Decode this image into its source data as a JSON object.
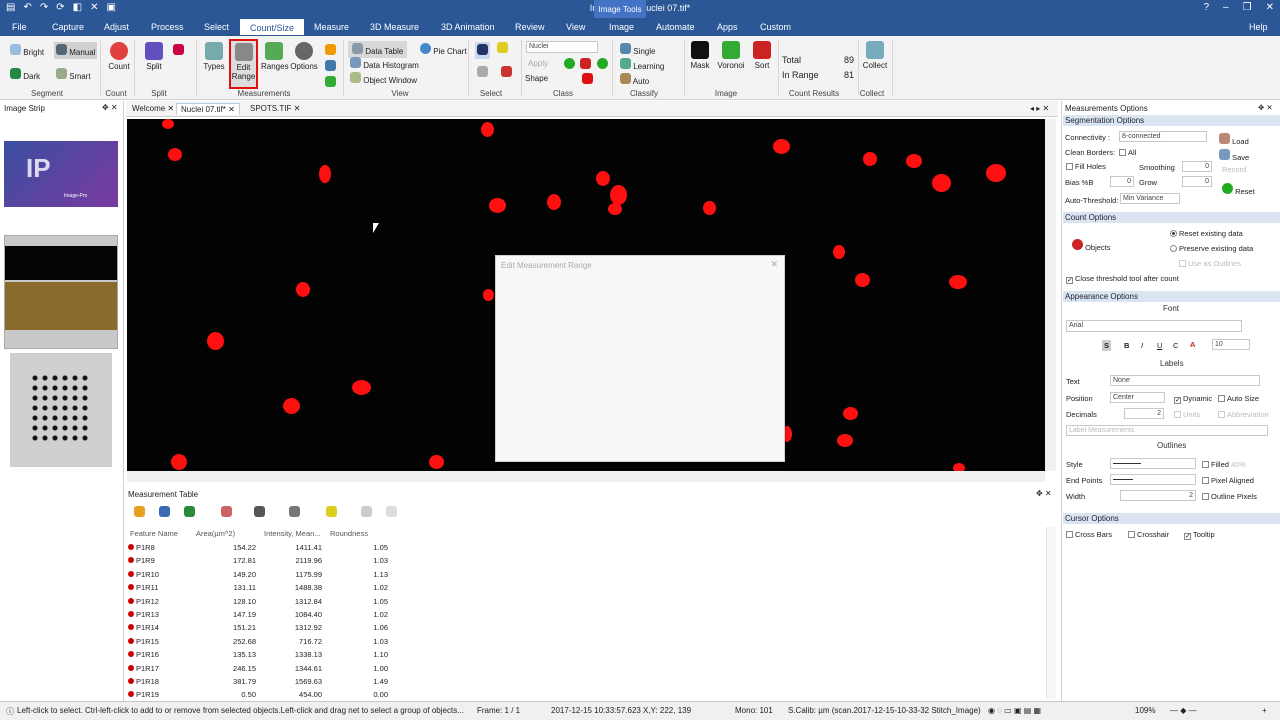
{
  "app": {
    "title": "Image-Pro - Nuclei 07.tif*",
    "context_tab_group": "Image Tools"
  },
  "menu": [
    "File",
    "Capture",
    "Adjust",
    "Process",
    "Select",
    "Count/Size",
    "Measure",
    "3D Measure",
    "3D Animation",
    "Review",
    "View",
    "Image",
    "Automate",
    "Apps",
    "Custom"
  ],
  "menu_active": "Count/Size",
  "help": "Help",
  "ribbon": {
    "segment": {
      "label": "Segment",
      "bright": "Bright",
      "manual": "Manual",
      "dark": "Dark",
      "smart": "Smart"
    },
    "count": {
      "label": "Count",
      "button": "Count"
    },
    "split": {
      "label": "Split",
      "button": "Split"
    },
    "measurements": {
      "label": "Measurements",
      "types": "Types",
      "edit_range": "Edit Range",
      "ranges": "Ranges",
      "options": "Options"
    },
    "view": {
      "label": "View",
      "data_table": "Data Table",
      "pie_chart": "Pie Chart",
      "data_histogram": "Data Histogram",
      "object_window": "Object Window"
    },
    "select": {
      "label": "Select"
    },
    "class": {
      "label": "Class",
      "dropdown": "Nuclei",
      "apply": "Apply",
      "shape": "Shape"
    },
    "classify": {
      "label": "Classify",
      "single": "Single",
      "learning": "Learning",
      "auto": "Auto"
    },
    "image": {
      "label": "Image",
      "mask": "Mask",
      "voronoi": "Voronoi",
      "sort": "Sort"
    },
    "count_results": {
      "label": "Count Results",
      "total_label": "Total",
      "total_value": "89",
      "inrange_label": "In Range",
      "inrange_value": "81"
    },
    "collect": {
      "label": "Collect",
      "button": "Collect"
    }
  },
  "image_strip": {
    "title": "Image Strip",
    "thumb1_text": "Image-Pro"
  },
  "doc_tabs": [
    "Welcome",
    "Nuclei 07.tif*",
    "SPOTS.TIF"
  ],
  "dialog": {
    "title": "Edit Measurement Range"
  },
  "measurement_table": {
    "title": "Measurement Table",
    "columns": [
      "Feature Name",
      "Area(µm^2)",
      "Intensity, Mean...",
      "Roundness"
    ],
    "rows": [
      [
        "P1R8",
        "154.22",
        "1411.41",
        "1.05"
      ],
      [
        "P1R9",
        "172.81",
        "2119.96",
        "1.03"
      ],
      [
        "P1R10",
        "149.20",
        "1175.99",
        "1.13"
      ],
      [
        "P1R11",
        "131.11",
        "1488.38",
        "1.02"
      ],
      [
        "P1R12",
        "128.10",
        "1312.84",
        "1.05"
      ],
      [
        "P1R13",
        "147.19",
        "1084.40",
        "1.02"
      ],
      [
        "P1R14",
        "151.21",
        "1312.92",
        "1.06"
      ],
      [
        "P1R15",
        "252.68",
        "716.72",
        "1.03"
      ],
      [
        "P1R16",
        "135.13",
        "1338.13",
        "1.10"
      ],
      [
        "P1R17",
        "246.15",
        "1344.61",
        "1.00"
      ],
      [
        "P1R18",
        "381.79",
        "1569.63",
        "1.49"
      ],
      [
        "P1R19",
        "0.50",
        "454.00",
        "0.00"
      ]
    ]
  },
  "options": {
    "title": "Measurements Options",
    "segmentation": {
      "head": "Segmentation Options",
      "connectivity_label": "Connectivity :",
      "connectivity_value": "8-connected",
      "load": "Load",
      "clean_borders_label": "Clean Borders:",
      "clean_borders_value": "All",
      "save": "Save",
      "fill_holes": "Fill Holes",
      "smoothing_label": "Smoothing",
      "smoothing_value": "0",
      "record": "Record",
      "bias_label": "Bias %B",
      "bias_value": "0",
      "grow_label": "Grow",
      "grow_value": "0",
      "reset": "Reset",
      "auto_threshold_label": "Auto-Threshold:",
      "auto_threshold_value": "Min Variance"
    },
    "count": {
      "head": "Count Options",
      "objects": "Objects",
      "reset_existing": "Reset existing data",
      "preserve_existing": "Preserve existing data",
      "use_as_outlines": "Use as Outlines",
      "close_threshold": "Close threshold tool after count"
    },
    "appearance": {
      "head": "Appearance Options",
      "font_label": "Font",
      "font_value": "Arial",
      "font_size": "10",
      "labels_label": "Labels",
      "text_label": "Text",
      "text_value": "None",
      "position_label": "Position",
      "position_value": "Center",
      "dynamic": "Dynamic",
      "auto_size": "Auto Size",
      "decimals_label": "Decimals",
      "decimals_value": "2",
      "units": "Units",
      "abbreviation": "Abbreviation",
      "label_measurements": "Label Measurements",
      "outlines_label": "Outlines",
      "style_label": "Style",
      "filled": "Filled",
      "filled_pct": "40%",
      "end_points_label": "End Points",
      "pixel_aligned": "Pixel Aligned",
      "width_label": "Width",
      "width_value": "2",
      "outline_pixels": "Outline Pixels"
    },
    "cursor": {
      "head": "Cursor Options",
      "cross_bars": "Cross Bars",
      "crosshair": "Crosshair",
      "tooltip": "Tooltip"
    }
  },
  "status": {
    "hint": "Left-click to select.  Ctrl-left-click to add to or remove from selected objects.Left-click and drag net to select a group of objects...",
    "frame": "Frame: 1 / 1",
    "timestamp": "2017-12-15 10:33:57.623",
    "xy": "X,Y: 222, 139",
    "mono": "Mono:  101",
    "calib": "S.Calib: µm (scan.2017-12-15-10-33-32 Stitch_Image)",
    "zoom": "109%"
  },
  "colors": {
    "brand": "#2b5797",
    "nuclei": "#ff1010",
    "highlight": "#e01010"
  }
}
